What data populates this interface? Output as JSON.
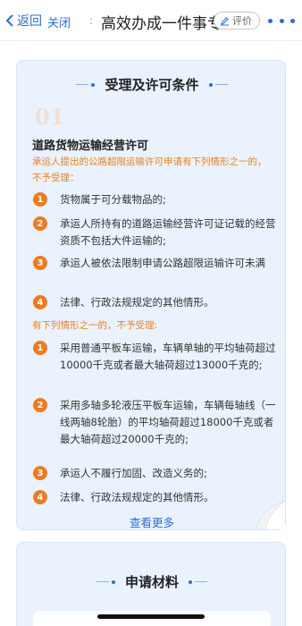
{
  "navbar": {
    "back_label": "返回",
    "close_label": "关闭",
    "divider": ":",
    "title": "高效办成一件事专",
    "rate_label": "评价"
  },
  "conditions": {
    "section_title": "受理及许可条件",
    "watermark": "01",
    "heading": "道路货物运输经营许可",
    "note1": "承运人提出的公路超限运输许可申请有下列情形之一的，不予受理：",
    "list1": [
      {
        "num": "1",
        "text": "货物属于可分载物品的;"
      },
      {
        "num": "2",
        "text": "承运人所持有的道路运输经营许可证记载的经营资质不包括大件运输的;"
      },
      {
        "num": "3",
        "text": "承运人被依法限制申请公路超限运输许可未满"
      },
      {
        "num": "4",
        "text": "法律、行政法规规定的其他情形。"
      }
    ],
    "note2": "有下列情形之一的，不予受理:",
    "list2": [
      {
        "num": "1",
        "text": "采用普通平板车运输，车辆单轴的平均轴荷超过10000千克或者最大轴荷超过13000千克的;"
      },
      {
        "num": "2",
        "text": "采用多轴多轮液压平板车运输，车辆每轴线（一线两轴8轮胎）的平均轴荷超过18000千克或者最大轴荷超过20000千克的;"
      },
      {
        "num": "3",
        "text": "承运人不履行加固、改造义务的;"
      },
      {
        "num": "4",
        "text": "法律、行政法规规定的其他情形。"
      }
    ],
    "see_more": "查看更多"
  },
  "materials": {
    "section_title": "申请材料"
  },
  "colors": {
    "accent_blue": "#2a6ed8",
    "orange": "#f07a1c",
    "panel_bg": "#e9f2fd"
  }
}
